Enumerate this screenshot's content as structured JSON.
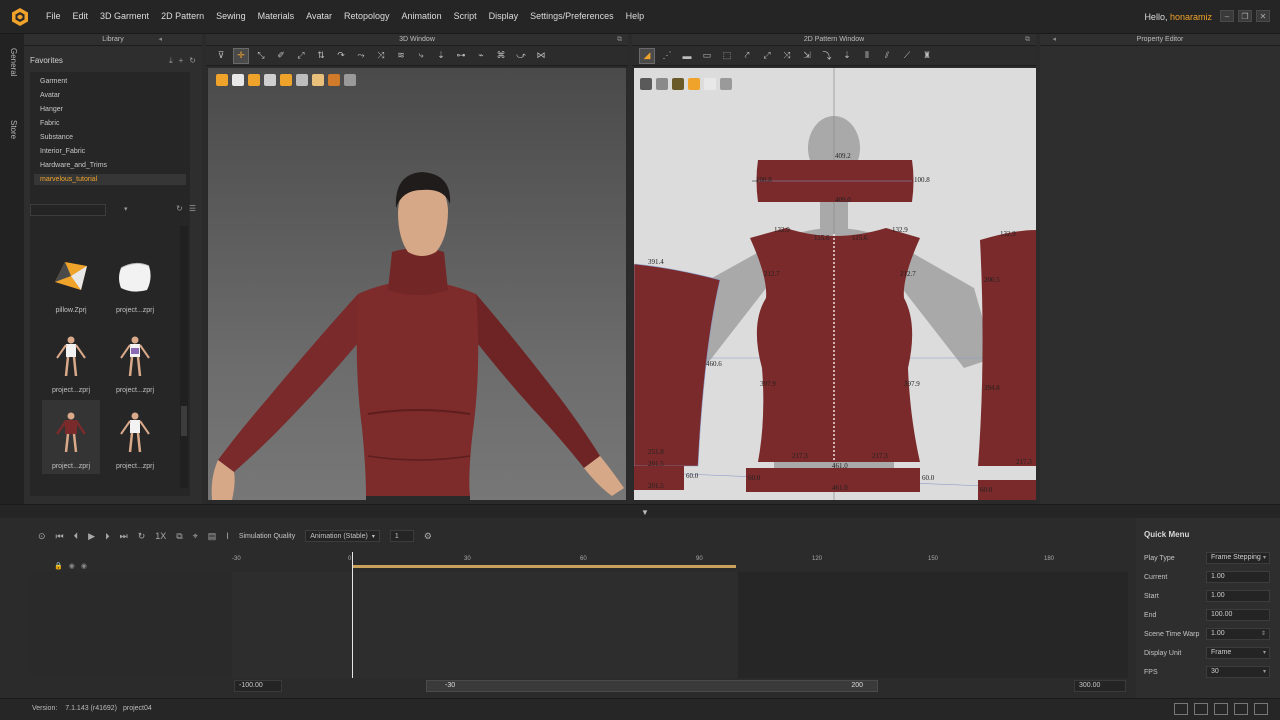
{
  "menubar": {
    "items": [
      "File",
      "Edit",
      "3D Garment",
      "2D Pattern",
      "Sewing",
      "Materials",
      "Avatar",
      "Retopology",
      "Animation",
      "Script",
      "Display",
      "Settings/Preferences",
      "Help"
    ],
    "greeting": "Hello,",
    "username": "honaramiz"
  },
  "vtabs": {
    "general": "General",
    "store": "Store"
  },
  "library": {
    "title": "Library",
    "favorites_title": "Favorites",
    "favorites": [
      "Garment",
      "Avatar",
      "Hanger",
      "Fabric",
      "Substance",
      "Interior_Fabric",
      "Hardware_and_Trims",
      "marvelous_tutorial"
    ],
    "selected_favorite": "marvelous_tutorial",
    "tiles": [
      "pillow.Zprj",
      "project...zprj",
      "project...zprj",
      "project...zprj",
      "project...zprj",
      "project...zprj"
    ]
  },
  "view3d": {
    "title": "3D Window"
  },
  "view2d": {
    "title": "2D Pattern Window",
    "measurements": {
      "collar_top": "409.2",
      "collar_bottom": "409.0",
      "collar_left": "100.8",
      "collar_right": "100.8",
      "body_top_left": "132.9",
      "body_top_right": "132.9",
      "neck_left": "115.6",
      "neck_right": "115.6",
      "armhole_left": "212.7",
      "armhole_right": "212.7",
      "side_left": "397.9",
      "side_right": "397.9",
      "hem_left": "217.3",
      "hem_right": "217.3",
      "hem": "461.0",
      "sleeve_left_top": "391.4",
      "sleeve_left_side": "460.6",
      "sleeve_left_bottom": "251.8",
      "sleeve_right_top": "132.9",
      "sleeve_right_arm": "200.5",
      "sleeve_right_side": "394.8",
      "sleeve_right_bottom": "217.3",
      "cuff_top": "201.5",
      "cuff_bottom": "201.5",
      "cuff_side": "60.0",
      "band_top": "461.0",
      "band_bottom": "461.0",
      "band_side_left": "60.0",
      "band_side_right": "60.0",
      "band_right_side": "60.0"
    }
  },
  "props": {
    "title": "Property Editor"
  },
  "timeline": {
    "sim_quality_label": "Simulation Quality",
    "sim_quality_value": "Animation (Stable)",
    "step_value": "1",
    "speed_label": "1X",
    "ruler_ticks": [
      "-30",
      "0",
      "30",
      "60",
      "90",
      "120",
      "150",
      "180"
    ],
    "range_start": "-100.00",
    "scroll_left": "-30",
    "scroll_right": "200",
    "range_end": "300.00"
  },
  "quick_menu": {
    "title": "Quick Menu",
    "rows": [
      {
        "label": "Play Type",
        "value": "Frame Stepping",
        "dropdown": true
      },
      {
        "label": "Current",
        "value": "1.00"
      },
      {
        "label": "Start",
        "value": "1.00"
      },
      {
        "label": "End",
        "value": "100.00"
      },
      {
        "label": "Scene Time Warp",
        "value": "1.00",
        "spinner": true
      },
      {
        "label": "Display Unit",
        "value": "Frame",
        "dropdown": true
      },
      {
        "label": "FPS",
        "value": "30",
        "dropdown": true
      }
    ]
  },
  "status": {
    "version_label": "Version:",
    "version": "7.1.143 (r41692)",
    "project": "project04"
  },
  "colors": {
    "accent": "#f0a32a",
    "fabric": "#7a2a2a",
    "canvas": "#dcdcdc"
  }
}
